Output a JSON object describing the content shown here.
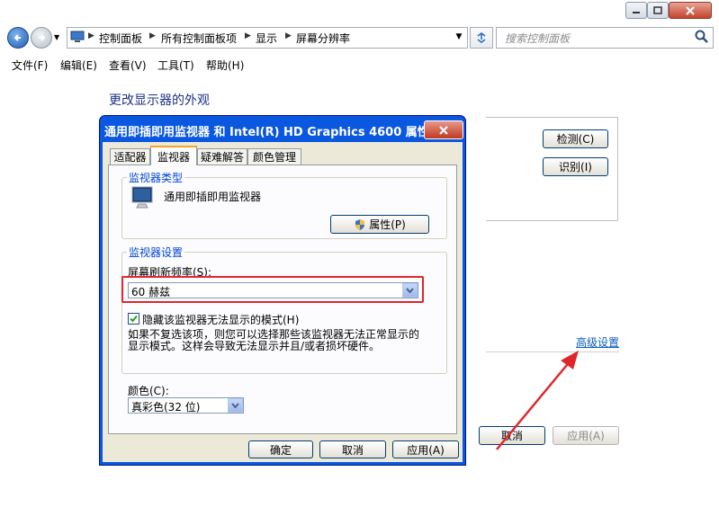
{
  "window": {
    "breadcrumbs": [
      "控制面板",
      "所有控制面板项",
      "显示",
      "屏幕分辨率"
    ],
    "search_placeholder": "搜索控制面板",
    "menu": [
      "文件(F)",
      "编辑(E)",
      "查看(V)",
      "工具(T)",
      "帮助(H)"
    ]
  },
  "main": {
    "heading": "更改显示器的外观",
    "detect_label": "检测(C)",
    "identify_label": "识别(I)",
    "advanced_link": "高级设置",
    "cancel_label": "取消",
    "apply_label": "应用(A)"
  },
  "dialog": {
    "title": "通用即插即用监视器 和 Intel(R) HD Graphics 4600 属性",
    "tabs": [
      "适配器",
      "监视器",
      "疑难解答",
      "颜色管理"
    ],
    "active_tab": "监视器",
    "monitor_type_group": "监视器类型",
    "monitor_name": "通用即插即用监视器",
    "properties_button": "属性(P)",
    "monitor_settings_group": "监视器设置",
    "refresh_label": "屏幕刷新频率(S):",
    "refresh_value": "60 赫兹",
    "hide_modes_label": "隐藏该监视器无法显示的模式(H)",
    "hide_modes_checked": true,
    "description_line1": "如果不复选该项，则您可以选择那些该监视器无法正常显示的",
    "description_line2": "显示模式。这样会导致无法显示并且/或者损坏硬件。",
    "color_label": "颜色(C):",
    "color_value": "真彩色(32 位)",
    "ok_label": "确定",
    "cancel_label": "取消",
    "apply_label": "应用(A)"
  },
  "colors": {
    "dialog_titlebar": "#0a57e0",
    "highlight_box": "#e0262b",
    "link": "#0b5dbf",
    "heading": "#1e3287"
  }
}
